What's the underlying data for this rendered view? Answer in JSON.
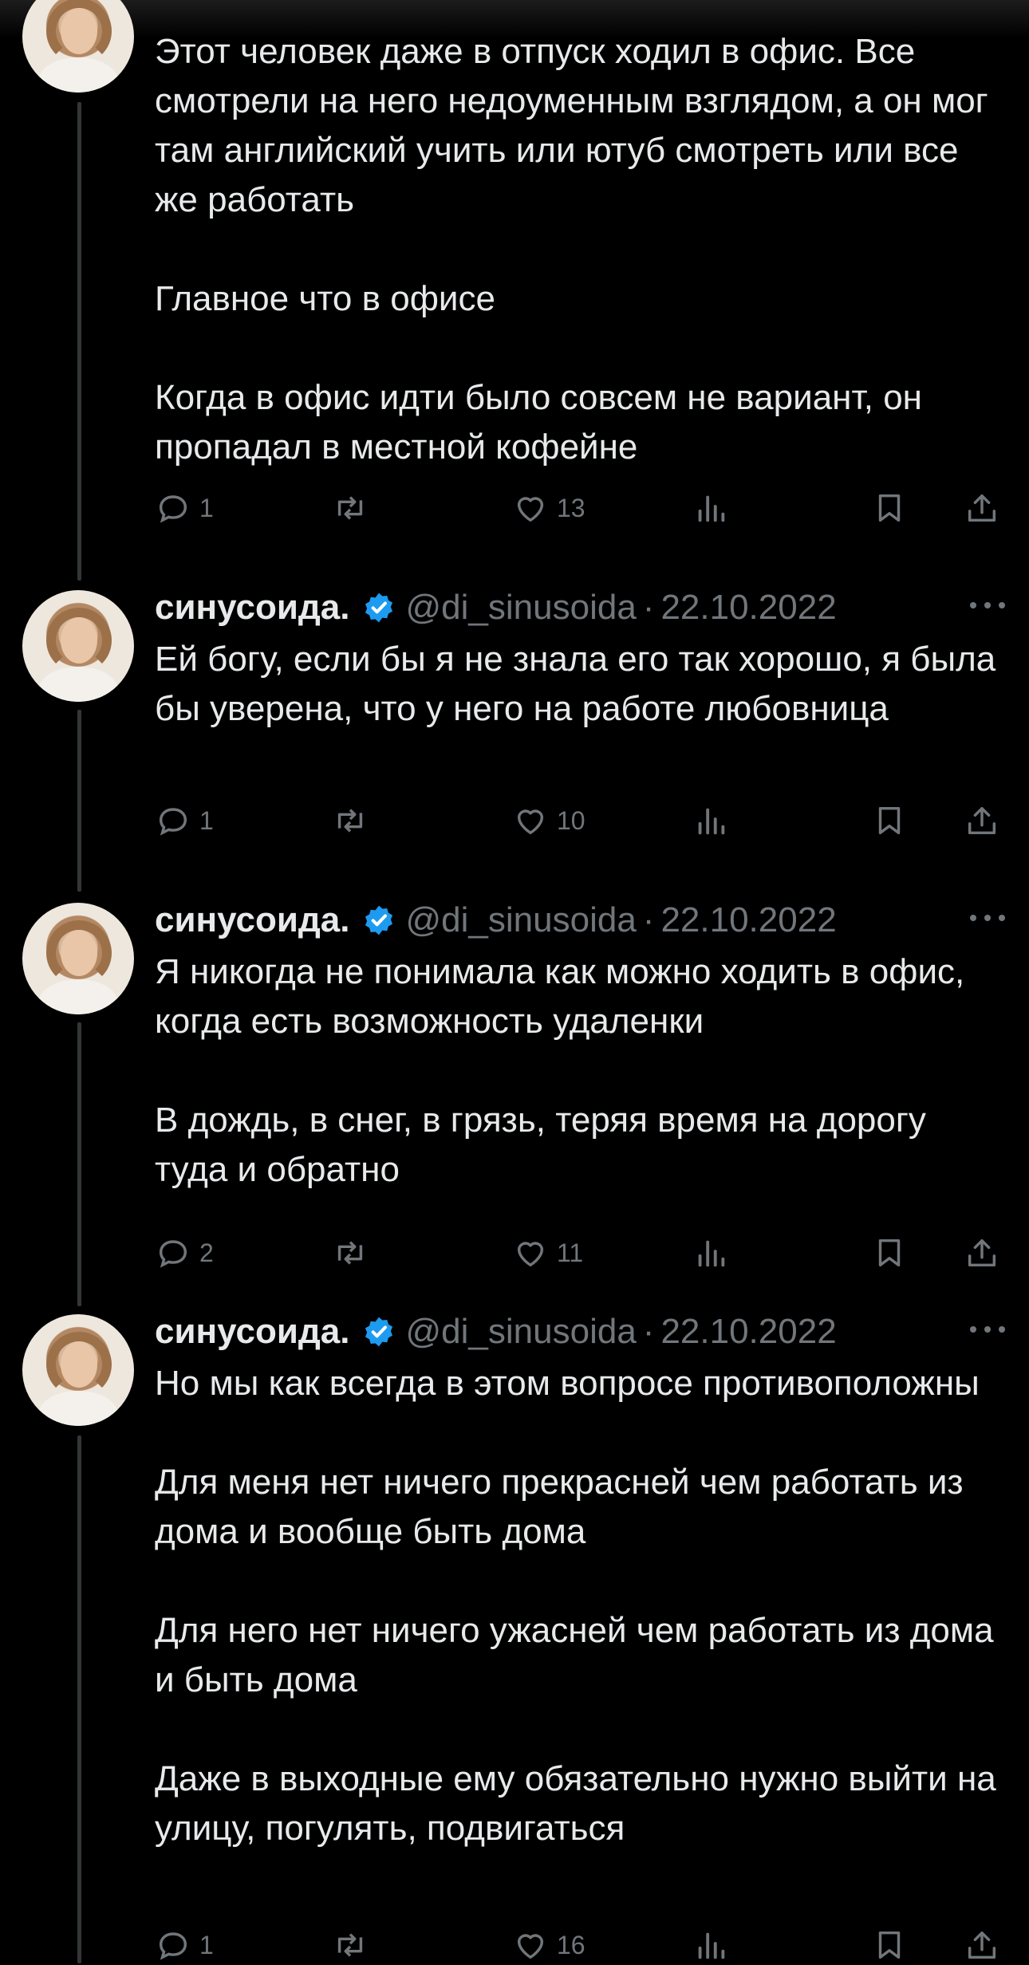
{
  "tweets": [
    {
      "author": "",
      "handle": "",
      "date": "",
      "paragraphs": [
        "Этот человек даже в отпуск ходил в офис. Все смотрели на него недоуменным взглядом, а он мог там английский учить или ютуб смотреть или все же работать",
        "Главное что в офисе",
        "Когда в офис идти было совсем не вариант, он пропадал в местной кофейне"
      ],
      "replies": "1",
      "retweets": "",
      "likes": "13"
    },
    {
      "author": "синусоида.",
      "handle": "@di_sinusoida",
      "date": "22.10.2022",
      "paragraphs": [
        "Ей богу, если бы я не знала его так хорошо, я была бы уверена, что у него на работе любовница"
      ],
      "replies": "1",
      "retweets": "",
      "likes": "10"
    },
    {
      "author": "синусоида.",
      "handle": "@di_sinusoida",
      "date": "22.10.2022",
      "paragraphs": [
        "Я никогда не понимала как можно ходить в офис, когда есть возможность удаленки",
        "В дождь, в снег, в грязь, теряя время на дорогу туда и обратно"
      ],
      "replies": "2",
      "retweets": "",
      "likes": "11"
    },
    {
      "author": "синусоида.",
      "handle": "@di_sinusoida",
      "date": "22.10.2022",
      "paragraphs": [
        "Но мы как всегда в этом вопросе противоположны",
        "Для меня нет ничего прекрасней чем работать из дома и вообще быть дома",
        "Для него нет ничего ужасней чем работать из дома и быть дома",
        "Даже в выходные ему обязательно нужно выйти на улицу, погулять, подвигаться"
      ],
      "replies": "1",
      "retweets": "",
      "likes": "16"
    }
  ],
  "separator": "·",
  "colors": {
    "background": "#000000",
    "text": "#e7e9ea",
    "muted": "#71767b",
    "verified": "#1d9bf0",
    "thread_line": "#333639"
  },
  "icons": [
    "reply-icon",
    "retweet-icon",
    "like-icon",
    "views-icon",
    "bookmark-icon",
    "share-icon",
    "verified-badge-icon",
    "more-icon"
  ]
}
